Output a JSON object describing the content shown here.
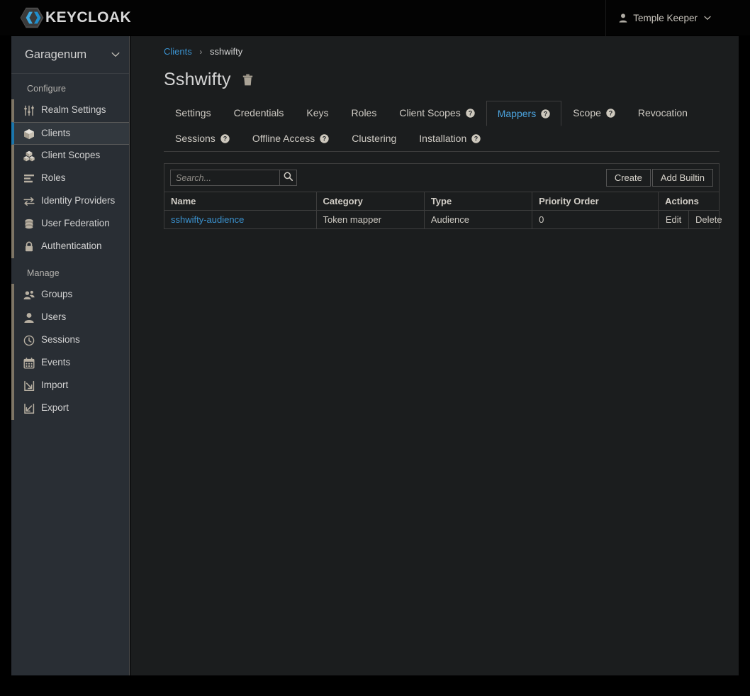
{
  "masthead": {
    "logo_text": "KEYCLOAK",
    "logo_icon": "keycloak-hexagon-logo",
    "user": {
      "icon": "user-icon",
      "name": "Temple Keeper",
      "caret_icon": "chevron-down-icon"
    }
  },
  "sidebar": {
    "realm": {
      "name": "Garagenum",
      "caret_icon": "chevron-down-icon"
    },
    "sections": [
      {
        "heading": "Configure",
        "items": [
          {
            "label": "Realm Settings",
            "icon": "sliders-icon",
            "active": false
          },
          {
            "label": "Clients",
            "icon": "cube-icon",
            "active": true
          },
          {
            "label": "Client Scopes",
            "icon": "cubes-icon",
            "active": false
          },
          {
            "label": "Roles",
            "icon": "list-icon",
            "active": false
          },
          {
            "label": "Identity Providers",
            "icon": "exchange-icon",
            "active": false
          },
          {
            "label": "User Federation",
            "icon": "database-icon",
            "active": false
          },
          {
            "label": "Authentication",
            "icon": "lock-icon",
            "active": false
          }
        ]
      },
      {
        "heading": "Manage",
        "items": [
          {
            "label": "Groups",
            "icon": "users-group-icon",
            "active": false
          },
          {
            "label": "Users",
            "icon": "user-icon",
            "active": false
          },
          {
            "label": "Sessions",
            "icon": "clock-icon",
            "active": false
          },
          {
            "label": "Events",
            "icon": "calendar-icon",
            "active": false
          },
          {
            "label": "Import",
            "icon": "import-arrow-icon",
            "active": false
          },
          {
            "label": "Export",
            "icon": "export-arrow-icon",
            "active": false
          }
        ]
      }
    ]
  },
  "content": {
    "breadcrumb": {
      "parent": "Clients",
      "separator": "›",
      "current": "sshwifty"
    },
    "title": "Sshwifty",
    "delete_icon": "trash-icon",
    "tabs": [
      {
        "label": "Settings",
        "help": false,
        "active": false
      },
      {
        "label": "Credentials",
        "help": false,
        "active": false
      },
      {
        "label": "Keys",
        "help": false,
        "active": false
      },
      {
        "label": "Roles",
        "help": false,
        "active": false
      },
      {
        "label": "Client Scopes",
        "help": true,
        "active": false
      },
      {
        "label": "Mappers",
        "help": true,
        "active": true
      },
      {
        "label": "Scope",
        "help": true,
        "active": false
      },
      {
        "label": "Revocation",
        "help": false,
        "active": false
      },
      {
        "label": "Sessions",
        "help": true,
        "active": false
      },
      {
        "label": "Offline Access",
        "help": true,
        "active": false
      },
      {
        "label": "Clustering",
        "help": false,
        "active": false
      },
      {
        "label": "Installation",
        "help": true,
        "active": false
      }
    ],
    "toolbar": {
      "search_placeholder": "Search...",
      "search_value": "",
      "search_icon": "search-icon",
      "create_label": "Create",
      "add_builtin_label": "Add Builtin"
    },
    "table": {
      "columns": [
        "Name",
        "Category",
        "Type",
        "Priority Order",
        "Actions"
      ],
      "rows": [
        {
          "name": "sshwifty-audience",
          "category": "Token mapper",
          "type": "Audience",
          "priority": "0",
          "edit_label": "Edit",
          "delete_label": "Delete"
        }
      ]
    }
  },
  "colors": {
    "accent_blue": "#1b76ac",
    "link_blue": "#3b92cf",
    "nav_bar_tan": "#7e7565",
    "sidebar_bg": "#292e34",
    "content_bg": "#1b1d1e",
    "masthead_bg": "#030303"
  }
}
